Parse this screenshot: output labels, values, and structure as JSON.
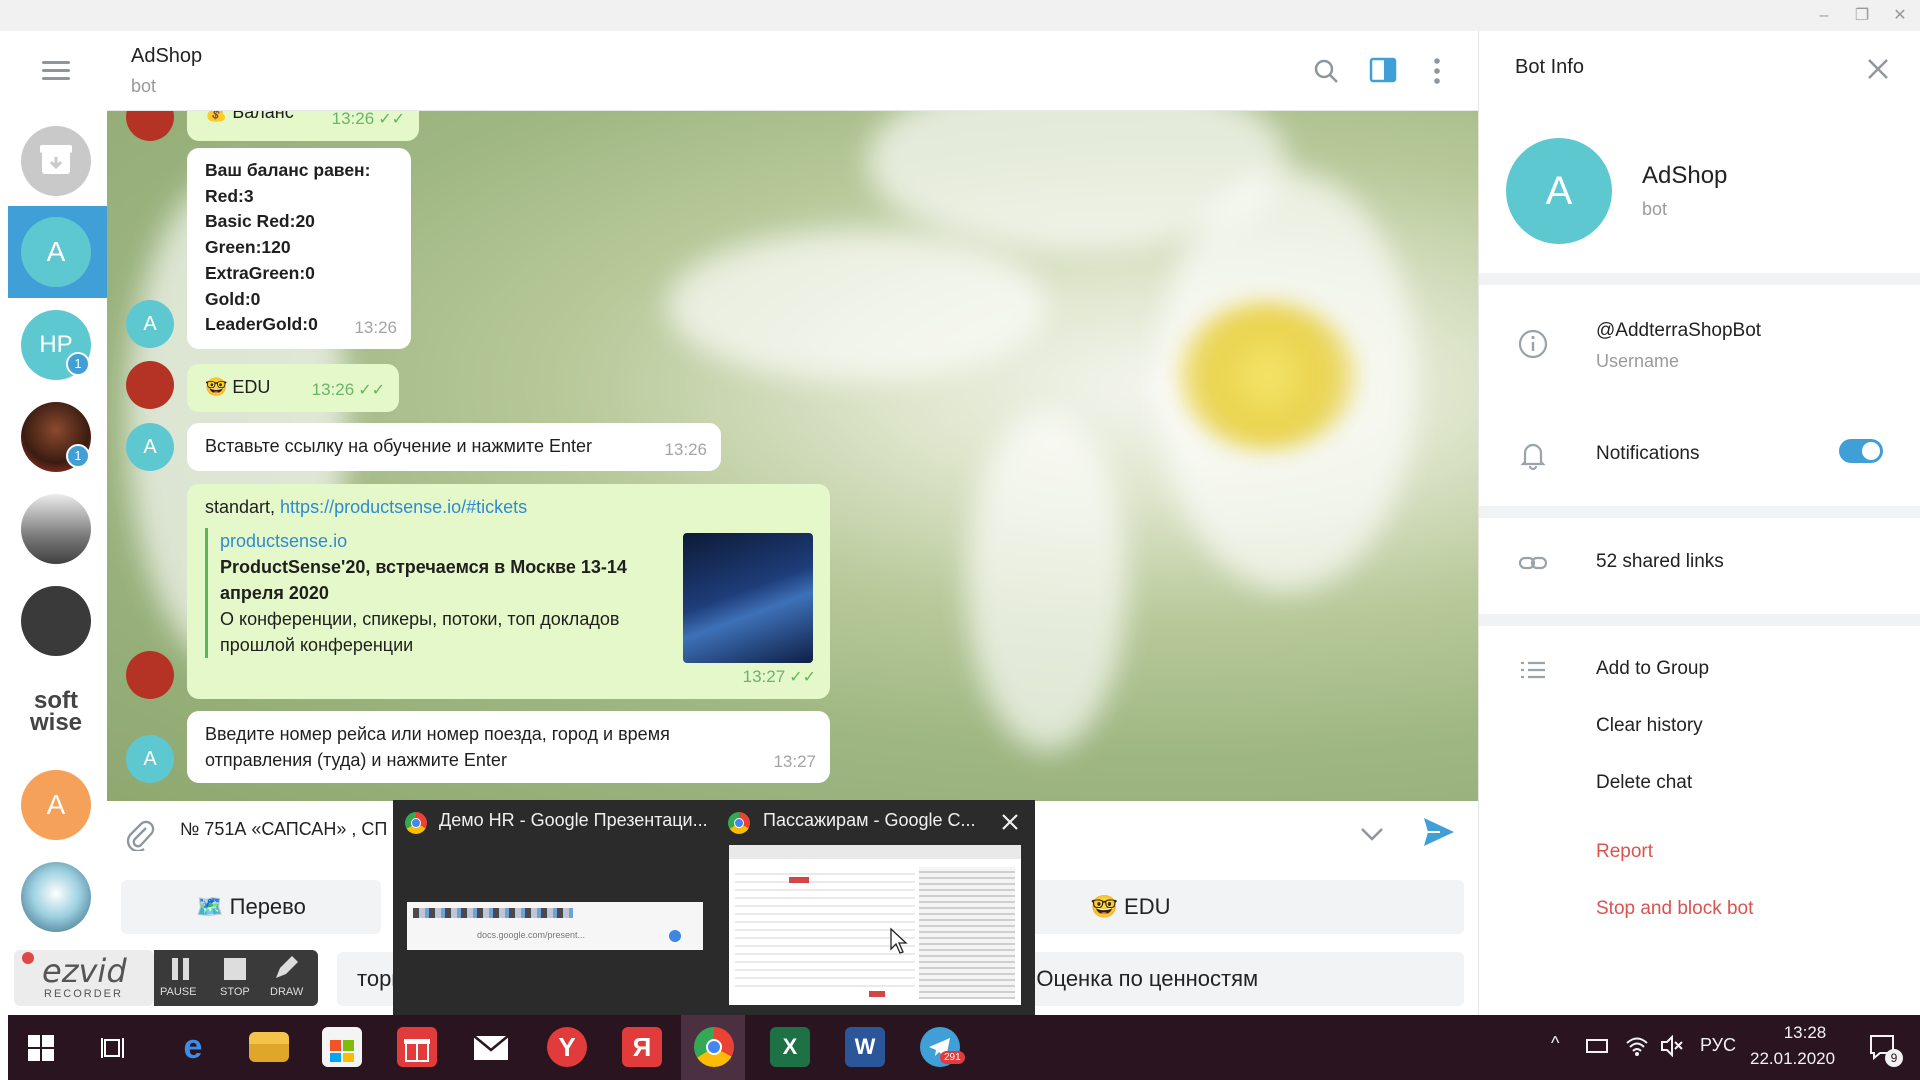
{
  "window": {
    "minimize": "–",
    "restore": "❐",
    "close": "✕"
  },
  "header": {
    "title": "AdShop",
    "subtitle": "bot"
  },
  "rail": {
    "items": [
      {
        "initials": "A"
      },
      {
        "initials": "HP",
        "badge": "1"
      },
      {
        "badge": "1"
      },
      {
        "initials": "soft wise"
      },
      {
        "initials": "A"
      }
    ]
  },
  "messages": {
    "m1": {
      "text": "💰 Баланс",
      "time": "13:26"
    },
    "m2": {
      "lines": [
        "Ваш баланс равен:",
        "Red:3",
        "Basic Red:20",
        "Green:120",
        "ExtraGreen:0",
        "Gold:0",
        "LeaderGold:0"
      ],
      "time": "13:26",
      "avatar": "A"
    },
    "m3": {
      "text": "🤓 EDU",
      "time": "13:26"
    },
    "m4": {
      "text": "Вставьте ссылку на обучение и нажмите Enter",
      "time": "13:26",
      "avatar": "A"
    },
    "m5": {
      "prefix": "standart, ",
      "link": "https://productsense.io/#tickets",
      "site": "productsense.io",
      "preview_title": "ProductSense'20, встречаемся в Москве 13-14 апреля 2020",
      "preview_desc": "О конференции, спикеры, потоки, топ докладов прошлой конференции",
      "time": "13:27"
    },
    "m6": {
      "text": "Введите номер рейса или номер поезда, город и время отправления (туда) и нажмите Enter",
      "time": "13:27",
      "avatar": "A"
    }
  },
  "composer": {
    "text": "№ 751А «САПСАН» , СП"
  },
  "keyboard": {
    "btn1": "🗺️ Перево",
    "btn2": "🤓 EDU",
    "btn3": "тори",
    "btn4": "✨ Оценка по ценностям"
  },
  "panel": {
    "title": "Bot Info",
    "name": "AdShop",
    "name_sub": "bot",
    "avatar": "A",
    "username": "@AddterraShopBot",
    "username_label": "Username",
    "notifications": "Notifications",
    "shared_links": "52 shared links",
    "add_group": "Add to Group",
    "clear_history": "Clear history",
    "delete_chat": "Delete chat",
    "report": "Report",
    "stop_block": "Stop and block bot"
  },
  "taskbar_popup": {
    "tab1": "Демо HR - Google Презентаци...",
    "tab2": "Пассажирам - Google C...",
    "url": "docs.google.com/present..."
  },
  "ezvid": {
    "logo_top": "ezvid",
    "logo_bottom": "RECORDER",
    "pause": "PAUSE",
    "stop": "STOP",
    "draw": "DRAW"
  },
  "taskbar": {
    "time": "13:28",
    "date": "22.01.2020",
    "lang": "РУС",
    "notif_count": "9",
    "telegram_badge": "291"
  },
  "colors": {
    "accent": "#3f9fd6",
    "bubble_out": "#e4f8c9",
    "danger": "#d9534f",
    "taskbar": "#2a1420"
  }
}
